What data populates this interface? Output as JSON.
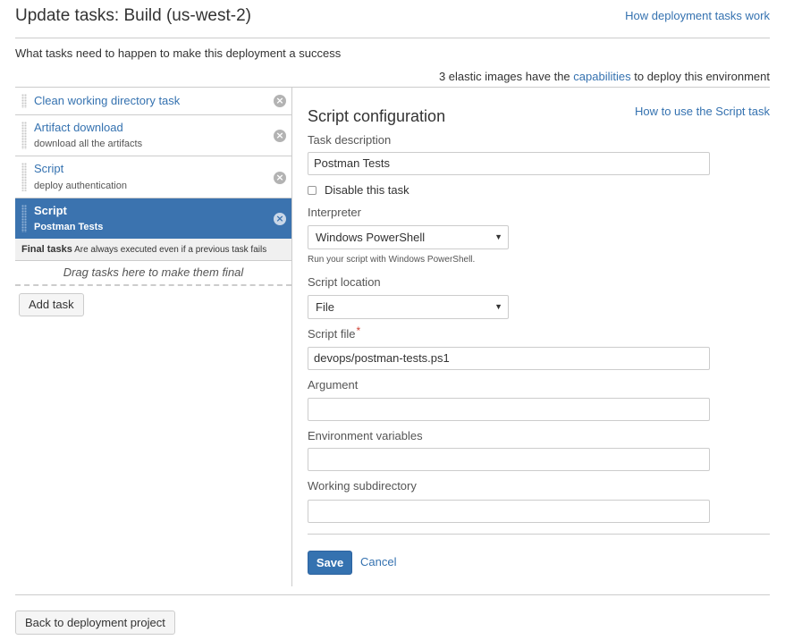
{
  "header": {
    "title": "Update tasks: Build (us-west-2)",
    "help_link": "How deployment tasks work"
  },
  "intro": {
    "text": "What tasks need to happen to make this deployment a success"
  },
  "capabilities": {
    "prefix": "3 elastic images have the",
    "link": "capabilities",
    "suffix": "to deploy this environment"
  },
  "tasks": [
    {
      "name": "Clean working directory task",
      "description": ""
    },
    {
      "name": "Artifact download",
      "description": "download all the artifacts"
    },
    {
      "name": "Script",
      "description": "deploy authentication"
    },
    {
      "name": "Script",
      "description": "Postman Tests",
      "selected": true
    }
  ],
  "final_tasks": {
    "title": "Final tasks",
    "note": "Are always executed even if a previous task fails",
    "drop_hint": "Drag tasks here to make them final"
  },
  "add_task_label": "Add task",
  "config": {
    "title": "Script configuration",
    "help_link": "How to use the Script task",
    "task_description_label": "Task description",
    "task_description_value": "Postman Tests",
    "disable_label": "Disable this task",
    "disable_checked": false,
    "interpreter_label": "Interpreter",
    "interpreter_value": "Windows PowerShell",
    "interpreter_hint": "Run your script with Windows PowerShell.",
    "location_label": "Script location",
    "location_value": "File",
    "script_file_label": "Script file",
    "script_file_required": "*",
    "script_file_value": "devops/postman-tests.ps1",
    "argument_label": "Argument",
    "argument_value": "",
    "env_vars_label": "Environment variables",
    "env_vars_value": "",
    "working_dir_label": "Working subdirectory",
    "working_dir_value": "",
    "save_label": "Save",
    "cancel_label": "Cancel"
  },
  "footer": {
    "back_label": "Back to deployment project"
  },
  "icons": {
    "remove": "close-circle-icon",
    "select": "chevron-down-icon",
    "drag": "drag-handle-icon"
  },
  "colors": {
    "link": "#3572b0",
    "selected_task_bg": "#3b73af",
    "primary_button": "#3572b0",
    "required": "#d04437"
  }
}
